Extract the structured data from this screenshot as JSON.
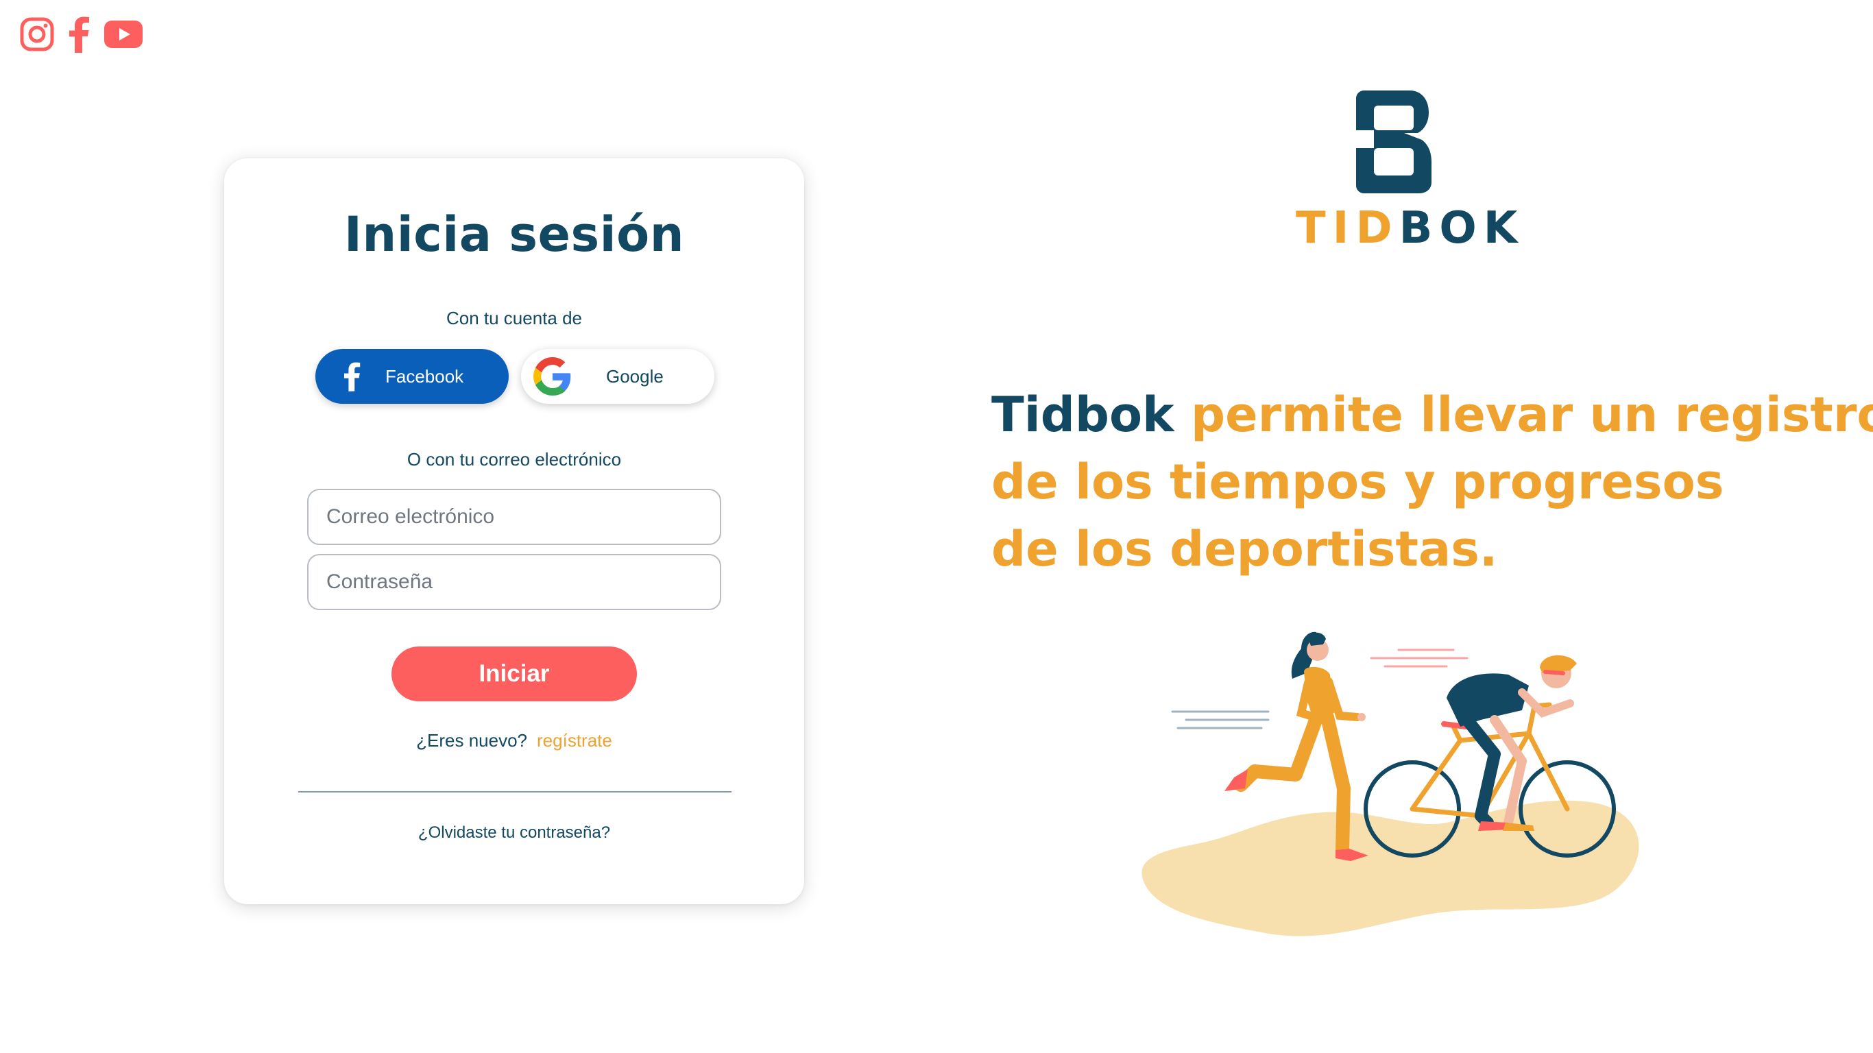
{
  "social": {
    "icons": [
      "instagram-icon",
      "facebook-icon",
      "youtube-icon"
    ],
    "color": "#fd5f5f"
  },
  "login": {
    "title": "Inicia sesión",
    "social_prompt": "Con tu cuenta de",
    "facebook_label": "Facebook",
    "google_label": "Google",
    "email_prompt": "O con tu correo electrónico",
    "email_placeholder": "Correo electrónico",
    "password_placeholder": "Contraseña",
    "submit_label": "Iniciar",
    "new_user_text": "¿Eres nuevo?",
    "register_link": "regístrate",
    "forgot_link": "¿Olvidaste tu contraseña?"
  },
  "brand": {
    "logo_letter": "B",
    "logo_word_part1": "TID",
    "logo_word_part2": "BOK",
    "tagline_brand": "Tidbok",
    "tagline_line1": "permite llevar un registro",
    "tagline_line2": "de los tiempos y progresos",
    "tagline_line3": "de los deportistas."
  },
  "colors": {
    "navy": "#124862",
    "orange": "#f0a22e",
    "coral": "#fd5f5f",
    "facebook_blue": "#0a5fba",
    "sand": "#f8dfae"
  }
}
